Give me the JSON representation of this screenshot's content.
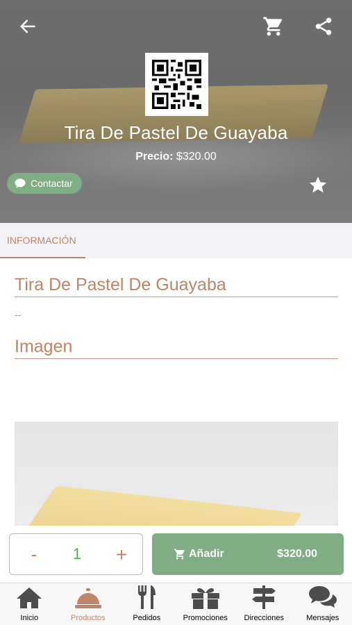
{
  "header": {
    "back_icon": "arrow-left-icon",
    "cart_icon": "cart-icon",
    "share_icon": "share-icon"
  },
  "hero": {
    "title": "Tira De Pastel De Guayaba",
    "price_label": "Precio:",
    "price_value": "$320.00",
    "contact_label": "Contactar",
    "favorite_icon": "star-icon"
  },
  "tabs": [
    {
      "label": "INFORMACIÓN",
      "active": true
    }
  ],
  "content": {
    "product_title": "Tira De Pastel De Guayaba",
    "description": "--",
    "image_section_title": "Imagen"
  },
  "action_bar": {
    "minus_label": "-",
    "quantity": "1",
    "plus_label": "+",
    "add_label": "Añadir",
    "add_price": "$320.00"
  },
  "bottom_nav": {
    "items": [
      {
        "label": "Inicio",
        "icon": "home-icon"
      },
      {
        "label": "Productos",
        "icon": "cloche-icon",
        "active": true
      },
      {
        "label": "Pedidos",
        "icon": "fork-knife-icon"
      },
      {
        "label": "Promociones",
        "icon": "gift-icon"
      },
      {
        "label": "Direcciones",
        "icon": "signpost-icon"
      },
      {
        "label": "Mensajes",
        "icon": "chat-bubbles-icon"
      }
    ]
  },
  "colors": {
    "accent": "#c08467",
    "green": "#7fae84",
    "quantity_text": "#4caf50"
  }
}
